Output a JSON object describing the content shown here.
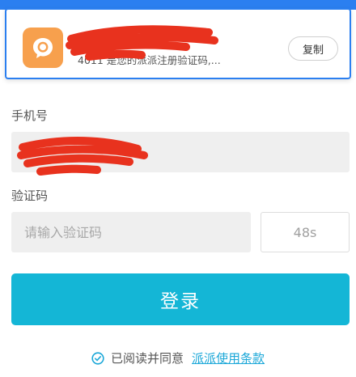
{
  "notification": {
    "app_icon": "chat-bubble-icon",
    "title": "",
    "body": "4011 是您的派派注册验证码,...",
    "copy_label": "复制"
  },
  "form": {
    "phone_label": "手机号",
    "phone_value": "",
    "code_label": "验证码",
    "code_placeholder": "请输入验证码",
    "countdown": "48s",
    "login_label": "登录"
  },
  "agreement": {
    "text": "已阅读并同意",
    "link": "派派使用条款"
  },
  "colors": {
    "accent_blue": "#2b7ff0",
    "button": "#14b6d6",
    "link": "#1aa7d8",
    "app_icon_bg": "#f7a04d",
    "redaction": "#e8321e"
  }
}
